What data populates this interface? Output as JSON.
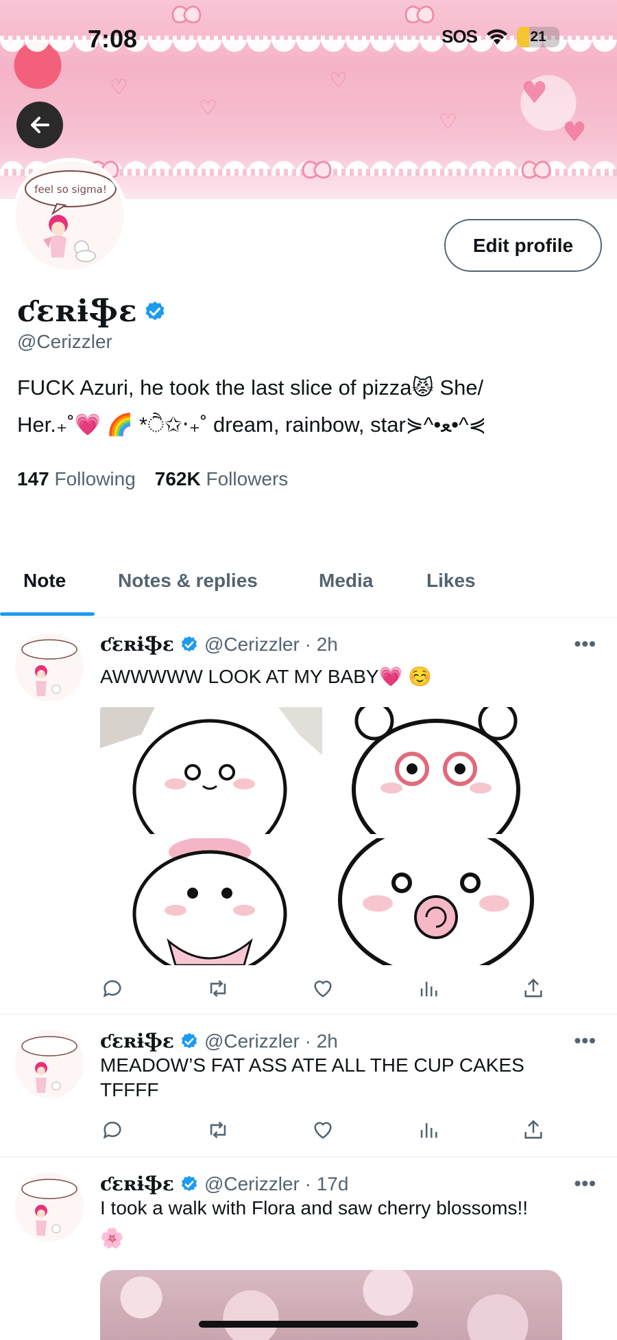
{
  "status_bar": {
    "time": "7:08",
    "sos": "SOS",
    "battery": "21"
  },
  "banner": {
    "avatar_speech": "feel so sigma!"
  },
  "profile": {
    "display_name": "ƈɛʀɨֆɛ",
    "handle": "@Cerizzler",
    "bio_line1": "FUCK Azuri, he took the last slice of pizza😾 She/",
    "bio_line2": "Her.₊˚💗 🌈 *ੈ✩‧₊˚  dream, rainbow, star⋟^•ﻌ•^⋞",
    "following_count": "147",
    "following_label": "Following",
    "followers_count": "762K",
    "followers_label": "Followers",
    "edit_label": "Edit profile"
  },
  "tabs": [
    {
      "label": "Note",
      "active": true
    },
    {
      "label": "Notes & replies",
      "active": false
    },
    {
      "label": "Media",
      "active": false
    },
    {
      "label": "Likes",
      "active": false
    }
  ],
  "posts": [
    {
      "name": "ƈɛʀɨֆɛ",
      "meta": "@Cerizzler · 2h",
      "text": "AWWWWW LOOK AT MY BABY💗 ☺️",
      "more": "•••"
    },
    {
      "name": "ƈɛʀɨֆɛ",
      "meta": "@Cerizzler · 2h",
      "text": "MEADOW’S FAT ASS ATE ALL THE CUP CAKES TFFFF",
      "more": "•••"
    },
    {
      "name": "ƈɛʀɨֆɛ",
      "meta": "@Cerizzler · 17d",
      "text": "I took a walk with Flora and saw cherry blossoms!!",
      "emoji": "🌸",
      "more": "•••"
    }
  ],
  "colors": {
    "accent": "#1d9bf0",
    "verified": "#1d9bf0",
    "banner_pink": "#f5b3c7",
    "muted": "#536471"
  }
}
